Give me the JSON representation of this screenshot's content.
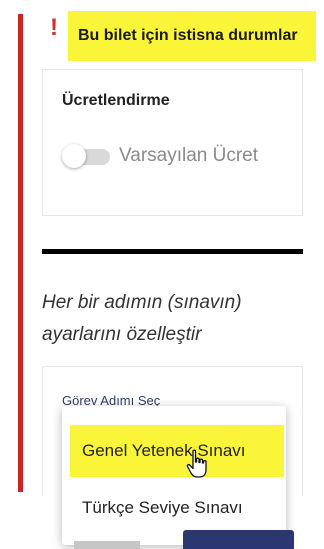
{
  "alert": {
    "icon": "exclamation-icon",
    "banner_text": "Bu bilet için istisna durumlar",
    "banner_color": "#fbf53a",
    "bar_color": "#c62828"
  },
  "pricing": {
    "title": "Ücretlendirme",
    "toggle_label": "Varsayılan Ücret",
    "toggle_on": false
  },
  "steps": {
    "description": "Her bir adımın (sınavın) ayarlarını özelleştir",
    "select_label": "Görev Adımı Seç",
    "options": [
      {
        "label": "Genel Yetenek Sınavı",
        "highlighted": true
      },
      {
        "label": "Türkçe Seviye Sınavı",
        "highlighted": false
      }
    ]
  },
  "icons": {
    "cursor": "hand-pointer-icon"
  }
}
